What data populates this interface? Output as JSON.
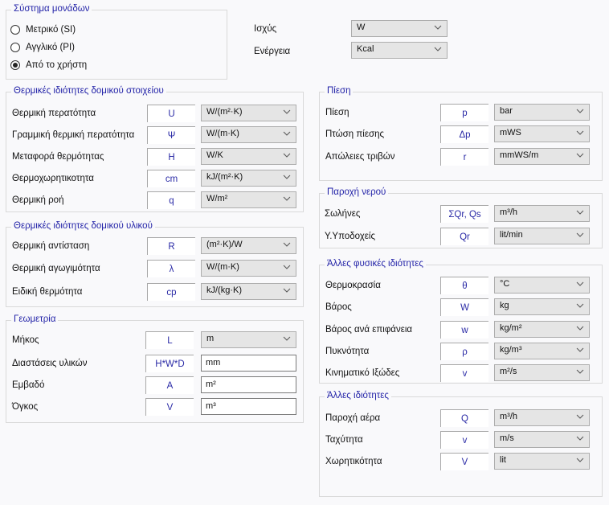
{
  "unit_system": {
    "title": "Σύστημα μονάδων",
    "options": [
      {
        "label": "Μετρικό (SI)",
        "selected": false
      },
      {
        "label": "Αγγλικό (PI)",
        "selected": false
      },
      {
        "label": "Από το χρήστη",
        "selected": true
      }
    ],
    "power_label": "Ισχύς",
    "power_value": "W",
    "energy_label": "Ενέργεια",
    "energy_value": "Kcal"
  },
  "groups": [
    {
      "id": "element-thermal",
      "title": "Θερμικές ιδιότητες δομικού στοιχείου",
      "rows": [
        {
          "label": "Θερμική περατότητα",
          "symbol": "U",
          "unit": "W/(m²·K)",
          "type": "combo"
        },
        {
          "label": "Γραμμική θερμική περατότητα",
          "symbol": "Ψ",
          "unit": "W/(m·K)",
          "type": "combo"
        },
        {
          "label": "Μεταφορά θερμότητας",
          "symbol": "H",
          "unit": "W/K",
          "type": "combo"
        },
        {
          "label": "Θερμοχωρητικοτητα",
          "symbol": "cm",
          "unit": "kJ/(m²·K)",
          "type": "combo"
        },
        {
          "label": "Θερμική ροή",
          "symbol": "q",
          "unit": "W/m²",
          "type": "combo"
        }
      ]
    },
    {
      "id": "material-thermal",
      "title": "Θερμικές ιδιότητες δομικού υλικού",
      "rows": [
        {
          "label": "Θερμική αντίσταση",
          "symbol": "R",
          "unit": "(m²·K)/W",
          "type": "combo"
        },
        {
          "label": "Θερμική αγωγιμότητα",
          "symbol": "λ",
          "unit": "W/(m·K)",
          "type": "combo"
        },
        {
          "label": "Ειδική θερμότητα",
          "symbol": "cp",
          "unit": "kJ/(kg·K)",
          "type": "combo"
        }
      ]
    },
    {
      "id": "geometry",
      "title": "Γεωμετρία",
      "rows": [
        {
          "label": "Μήκος",
          "symbol": "L",
          "unit": "m",
          "type": "combo"
        },
        {
          "label": "Διαστάσεις υλικών",
          "symbol": "H*W*D",
          "unit": "mm",
          "type": "text"
        },
        {
          "label": "Εμβαδό",
          "symbol": "A",
          "unit": "m²",
          "type": "text"
        },
        {
          "label": "Όγκος",
          "symbol": "V",
          "unit": "m³",
          "type": "text"
        }
      ]
    },
    {
      "id": "pressure",
      "title": "Πίεση",
      "rows": [
        {
          "label": "Πίεση",
          "symbol": "p",
          "unit": "bar",
          "type": "combo"
        },
        {
          "label": "Πτώση πίεσης",
          "symbol": "Δp",
          "unit": "mWS",
          "type": "combo"
        },
        {
          "label": "Απώλειες τριβών",
          "symbol": "r",
          "unit": "mmWS/m",
          "type": "combo"
        }
      ]
    },
    {
      "id": "water-flow",
      "title": "Παροχή νερού",
      "rows": [
        {
          "label": "Σωλήνες",
          "symbol": "ΣQr, Qs",
          "unit": "m³/h",
          "type": "combo"
        },
        {
          "label": "Υ.Υποδοχείς",
          "symbol": "Qr",
          "unit": "lit/min",
          "type": "combo"
        }
      ]
    },
    {
      "id": "other-physical",
      "title": "Άλλες φυσικές ιδιότητες",
      "rows": [
        {
          "label": "Θερμοκρασία",
          "symbol": "θ",
          "unit": "°C",
          "type": "combo"
        },
        {
          "label": "Βάρος",
          "symbol": "W",
          "unit": "kg",
          "type": "combo"
        },
        {
          "label": "Βάρος ανά επιφάνεια",
          "symbol": "w",
          "unit": "kg/m²",
          "type": "combo"
        },
        {
          "label": "Πυκνότητα",
          "symbol": "ρ",
          "unit": "kg/m³",
          "type": "combo"
        },
        {
          "label": "Κινηματικό Ιξώδες",
          "symbol": "v",
          "unit": "m²/s",
          "type": "combo"
        }
      ]
    },
    {
      "id": "other",
      "title": "Άλλες ιδιότητες",
      "rows": [
        {
          "label": "Παροχή αέρα",
          "symbol": "Q",
          "unit": "m³/h",
          "type": "combo"
        },
        {
          "label": "Ταχύτητα",
          "symbol": "v",
          "unit": "m/s",
          "type": "combo"
        },
        {
          "label": "Χωρητικότητα",
          "symbol": "V",
          "unit": "lit",
          "type": "combo"
        }
      ]
    }
  ]
}
